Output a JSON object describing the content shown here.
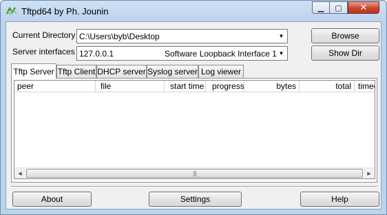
{
  "window": {
    "title": "Tftpd64 by Ph. Jounin",
    "minimize_glyph": "▁",
    "maximize_glyph": "▢",
    "close_glyph": "✕",
    "close_color": "#c8452c"
  },
  "icons": {
    "app": "tftpd-app-icon",
    "dropdown": "chevron-down-icon"
  },
  "config": {
    "current_directory_label": "Current Directory",
    "current_directory_value": "C:\\Users\\byb\\Desktop",
    "server_interfaces_label": "Server interfaces",
    "server_interfaces_ip": "127.0.0.1",
    "server_interfaces_name": "Software Loopback Interface 1",
    "browse_label": "Browse",
    "show_dir_label": "Show Dir"
  },
  "tabs": [
    {
      "label": "Tftp Server",
      "active": true
    },
    {
      "label": "Tftp Client",
      "active": false
    },
    {
      "label": "DHCP server",
      "active": false
    },
    {
      "label": "Syslog server",
      "active": false
    },
    {
      "label": "Log viewer",
      "active": false
    }
  ],
  "table": {
    "columns": [
      "peer",
      "file",
      "start time",
      "progress",
      "bytes",
      "total",
      "timeo."
    ],
    "rows": []
  },
  "scrollbar": {
    "left_glyph": "◀",
    "right_glyph": "▶",
    "grip_glyph": "|||"
  },
  "footer": {
    "about_label": "About",
    "settings_label": "Settings",
    "help_label": "Help"
  }
}
